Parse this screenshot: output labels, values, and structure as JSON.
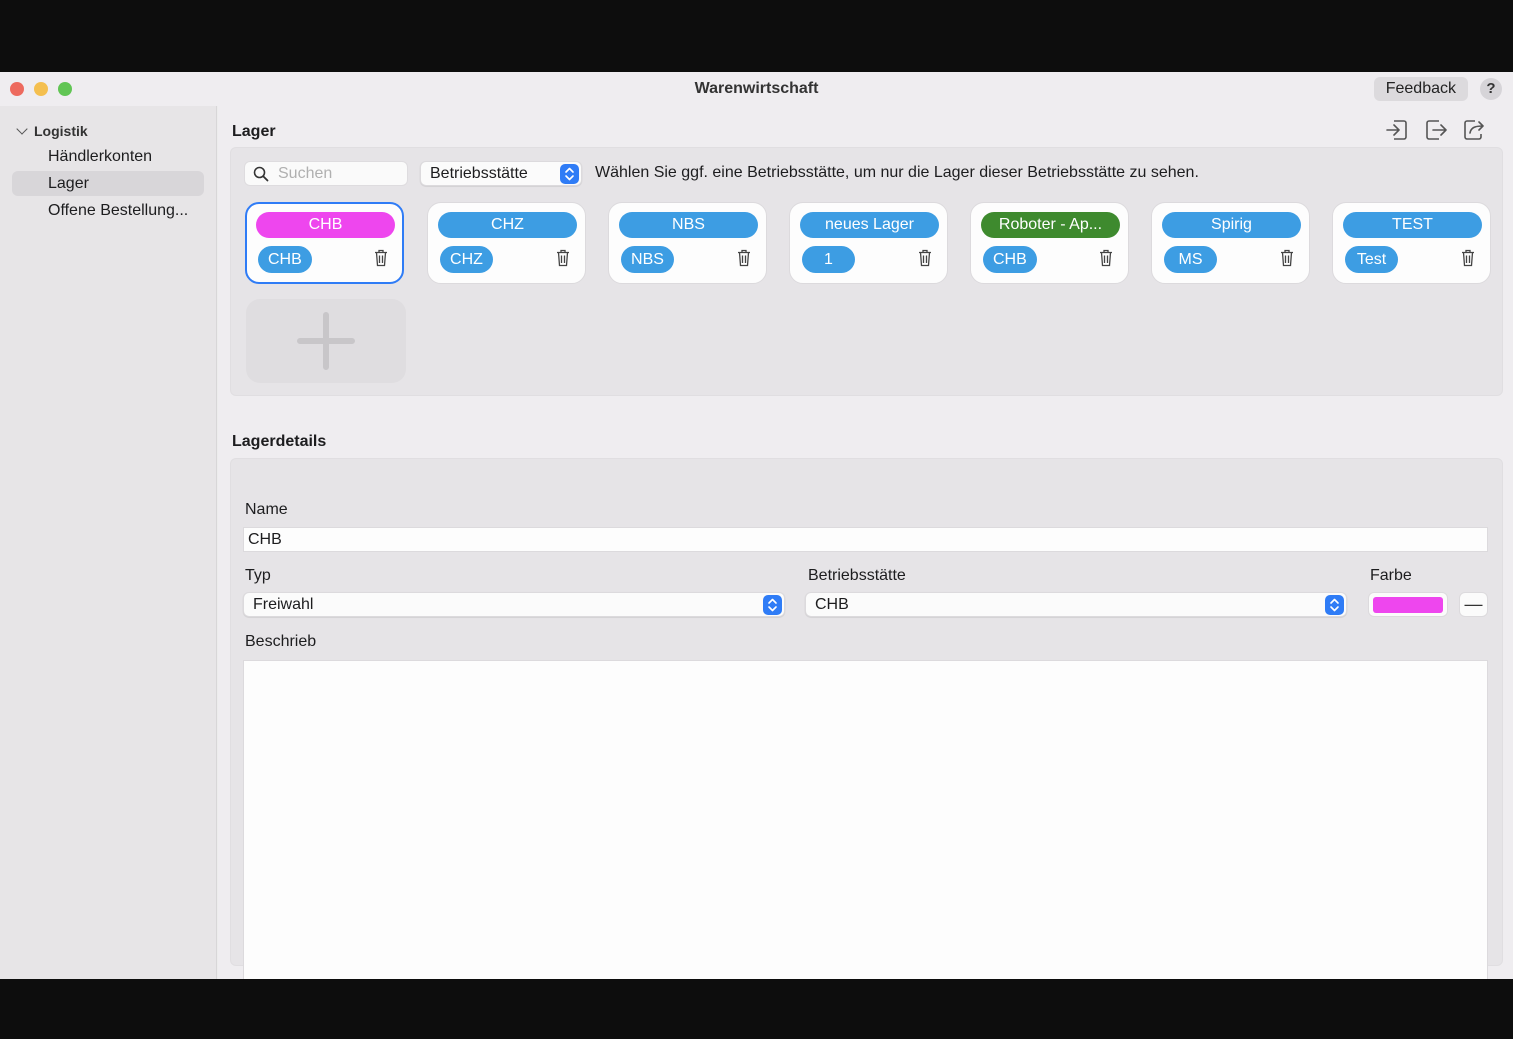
{
  "window": {
    "title": "Warenwirtschaft",
    "feedback_label": "Feedback",
    "help_label": "?"
  },
  "sidebar": {
    "group_label": "Logistik",
    "items": [
      {
        "label": "Händlerkonten",
        "active": false
      },
      {
        "label": "Lager",
        "active": true
      },
      {
        "label": "Offene Bestellung...",
        "active": false
      }
    ]
  },
  "lager": {
    "title": "Lager",
    "toolbar_icons": [
      "import-icon",
      "export-icon",
      "share-icon"
    ],
    "search": {
      "placeholder": "Suchen",
      "value": ""
    },
    "betriebsstaette_filter": {
      "value": "Betriebsstätte"
    },
    "hint": "Wählen Sie ggf. eine Betriebsstätte, um nur die Lager dieser Betriebsstätte zu sehen.",
    "cards": [
      {
        "name": "CHB",
        "betriebsstaette": "CHB",
        "color": "#ee46ee",
        "selected": true
      },
      {
        "name": "CHZ",
        "betriebsstaette": "CHZ",
        "color": "#3d9de3",
        "selected": false
      },
      {
        "name": "NBS",
        "betriebsstaette": "NBS",
        "color": "#3d9de3",
        "selected": false
      },
      {
        "name": "neues Lager",
        "betriebsstaette": "1",
        "color": "#3d9de3",
        "selected": false
      },
      {
        "name": "Roboter - Ap...",
        "betriebsstaette": "CHB",
        "color": "#3e8a2e",
        "selected": false
      },
      {
        "name": "Spirig",
        "betriebsstaette": "MS",
        "color": "#3d9de3",
        "selected": false
      },
      {
        "name": "TEST",
        "betriebsstaette": "Test",
        "color": "#3d9de3",
        "selected": false
      }
    ],
    "add_label": "+"
  },
  "details": {
    "title": "Lagerdetails",
    "name_label": "Name",
    "name_value": "CHB",
    "typ_label": "Typ",
    "typ_value": "Freiwahl",
    "betriebsstaette_label": "Betriebsstätte",
    "betriebsstaette_value": "CHB",
    "farbe_label": "Farbe",
    "farbe_value": "#ee46ee",
    "remove_color_label": "—",
    "beschrieb_label": "Beschrieb",
    "beschrieb_value": ""
  }
}
